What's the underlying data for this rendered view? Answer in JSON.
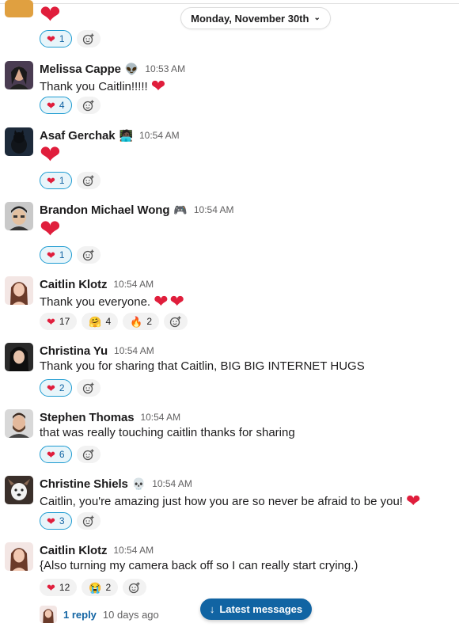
{
  "date_divider": "Monday, November 30th",
  "top_message": {
    "reaction_count": "1"
  },
  "messages": [
    {
      "name": "Melissa Cappe",
      "status": "👽",
      "time": "10:53 AM",
      "text": "Thank you Caitlin!!!!!",
      "reaction_count": "4"
    },
    {
      "name": "Asaf Gerchak",
      "status": "🧑🏿‍💻",
      "time": "10:54 AM",
      "reaction_count": "1"
    },
    {
      "name": "Brandon Michael Wong",
      "status": "🎮",
      "time": "10:54 AM",
      "reaction_count": "1"
    },
    {
      "name": "Caitlin Klotz",
      "time": "10:54 AM",
      "text": "Thank you everyone.",
      "reactions": [
        {
          "emoji": "❤️",
          "count": "17"
        },
        {
          "emoji": "🤗",
          "count": "4"
        },
        {
          "emoji": "🔥",
          "count": "2"
        }
      ]
    },
    {
      "name": "Christina Yu",
      "time": "10:54 AM",
      "text": "Thank you for sharing that Caitlin, BIG BIG INTERNET HUGS",
      "reaction_count": "2"
    },
    {
      "name": "Stephen Thomas",
      "time": "10:54 AM",
      "text": "that was really touching caitlin thanks for sharing",
      "reaction_count": "6"
    },
    {
      "name": "Christine Shiels",
      "status": "💀",
      "time": "10:54 AM",
      "text": "Caitlin, you're amazing just how you are so never be afraid to be you!",
      "reaction_count": "3"
    },
    {
      "name": "Caitlin Klotz",
      "time": "10:54 AM",
      "text": "{Also turning my camera back off so I can really start crying.)",
      "reactions": [
        {
          "emoji": "❤️",
          "count": "12"
        },
        {
          "emoji": "😭",
          "count": "2"
        }
      ]
    }
  ],
  "thread": {
    "reply_label": "1 reply",
    "reply_time": "10 days ago"
  },
  "latest_button": "Latest messages",
  "colors": {
    "heart": "#e01e3c",
    "link": "#1264a3",
    "button": "#1164a3"
  }
}
